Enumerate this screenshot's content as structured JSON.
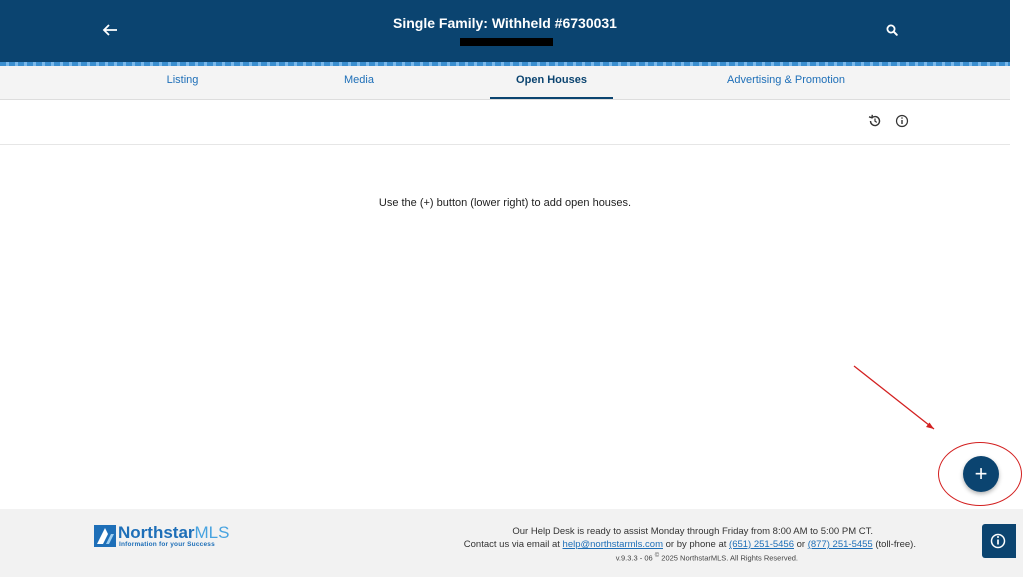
{
  "header": {
    "title": "Single Family: Withheld #6730031",
    "back_icon": "arrow-left-icon",
    "search_icon": "search-icon"
  },
  "tabs": [
    {
      "label": "Listing",
      "active": false
    },
    {
      "label": "Media",
      "active": false
    },
    {
      "label": "Open Houses",
      "active": true
    },
    {
      "label": "Advertising & Promotion",
      "active": false
    }
  ],
  "toolbar": {
    "history_icon": "history-icon",
    "info_icon": "info-icon"
  },
  "main": {
    "message": "Use the (+) button (lower right) to add open houses."
  },
  "fab": {
    "label": "+"
  },
  "footer": {
    "logo_name_a": "Northstar",
    "logo_name_b": "MLS",
    "logo_tagline": "Information for your Success",
    "help_line": "Our Help Desk is ready to assist Monday through Friday from 8:00 AM to 5:00 PM CT.",
    "contact_prefix": "Contact us via email at ",
    "email": "help@northstarmls.com",
    "contact_mid": " or by phone at ",
    "phone1": "(651) 251-5456",
    "contact_or": " or ",
    "phone2": "(877) 251-5455",
    "contact_suffix": " (toll-free).",
    "version_prefix": "v.9.3.3 - 06 ",
    "copyright_symbol": "©",
    "version_suffix": " 2025 NorthstarMLS. All Rights Reserved."
  },
  "colors": {
    "header_bg": "#0b4470",
    "accent": "#1e6fb8",
    "annotation": "#d32020"
  }
}
